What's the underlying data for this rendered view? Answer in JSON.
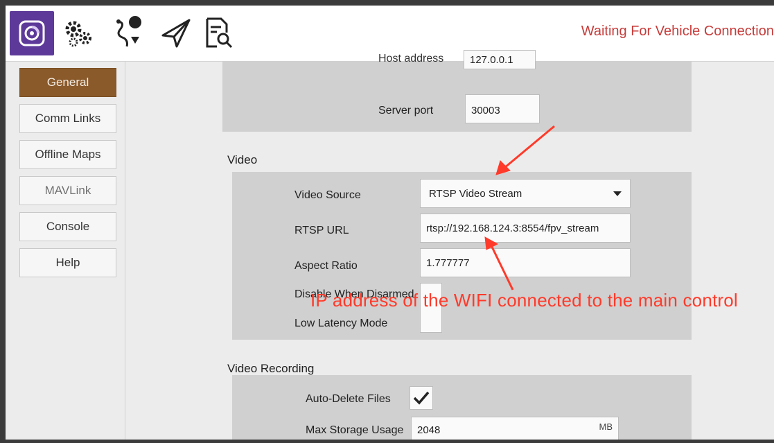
{
  "toolbar": {
    "status": "Waiting For Vehicle Connection",
    "icons": [
      "app-logo-icon",
      "settings-gears-icon",
      "plan-route-icon",
      "fly-paper-plane-icon",
      "analyze-document-icon"
    ]
  },
  "sidebar": {
    "items": [
      {
        "label": "General"
      },
      {
        "label": "Comm Links"
      },
      {
        "label": "Offline Maps"
      },
      {
        "label": "MAVLink"
      },
      {
        "label": "Console"
      },
      {
        "label": "Help"
      }
    ]
  },
  "server": {
    "host_label": "Host address",
    "host_value": "127.0.0.1",
    "port_label": "Server port",
    "port_value": "30003"
  },
  "video": {
    "title": "Video",
    "source_label": "Video Source",
    "source_value": "RTSP Video Stream",
    "rtsp_label": "RTSP URL",
    "rtsp_value": "rtsp://192.168.124.3:8554/fpv_stream",
    "aspect_label": "Aspect Ratio",
    "aspect_value": "1.777777",
    "disable_label": "Disable When Disarmed",
    "latency_label": "Low Latency Mode"
  },
  "recording": {
    "title": "Video Recording",
    "autodelete_label": "Auto-Delete Files",
    "autodelete_checked": true,
    "max_label": "Max Storage Usage",
    "max_value": "2048",
    "max_unit": "MB"
  },
  "annotation": {
    "text": "IP address of the WIFI connected to the main control"
  },
  "colors": {
    "active_tab": "#8a5a2b",
    "status": "#c63c3a",
    "annotation": "#ff3a2a",
    "app_icon_bg": "#5d3a9a"
  }
}
